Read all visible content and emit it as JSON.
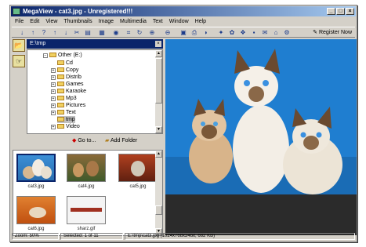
{
  "window": {
    "title": "MegaView - cat3.jpg - Unregistered!!!"
  },
  "menubar": [
    "File",
    "Edit",
    "View",
    "Thumbnails",
    "Image",
    "Multimedia",
    "Text",
    "Window",
    "Help"
  ],
  "toolbar": {
    "register_label": "Register Now"
  },
  "folder_panel": {
    "path": "E:\\tmp",
    "root": "Other (E:)",
    "folders": [
      "Cd",
      "Copy",
      "Distrib",
      "Games",
      "Karaoke",
      "Mp3",
      "Pictures",
      "Text",
      "tmp",
      "Video"
    ],
    "selected": "tmp",
    "goto_label": "Go to...",
    "add_folder_label": "Add Folder"
  },
  "thumbnails": [
    {
      "name": "cat3.jpg",
      "selected": true
    },
    {
      "name": "cat4.jpg",
      "selected": false
    },
    {
      "name": "cat5.jpg",
      "selected": false
    },
    {
      "name": "cat6.jpg",
      "selected": false
    },
    {
      "name": "sharz.gif",
      "selected": false
    }
  ],
  "status": {
    "zoom": "Zoom: 50%",
    "selected": "Selected: 1 of 11",
    "file": "E:\\tmp\\cat3.jpg (1024x768x24bit, 682 KB)"
  },
  "colors": {
    "titlebar": "#0a246a",
    "viewer_bg": "#1a77c8",
    "chrome": "#d4d0c8"
  }
}
